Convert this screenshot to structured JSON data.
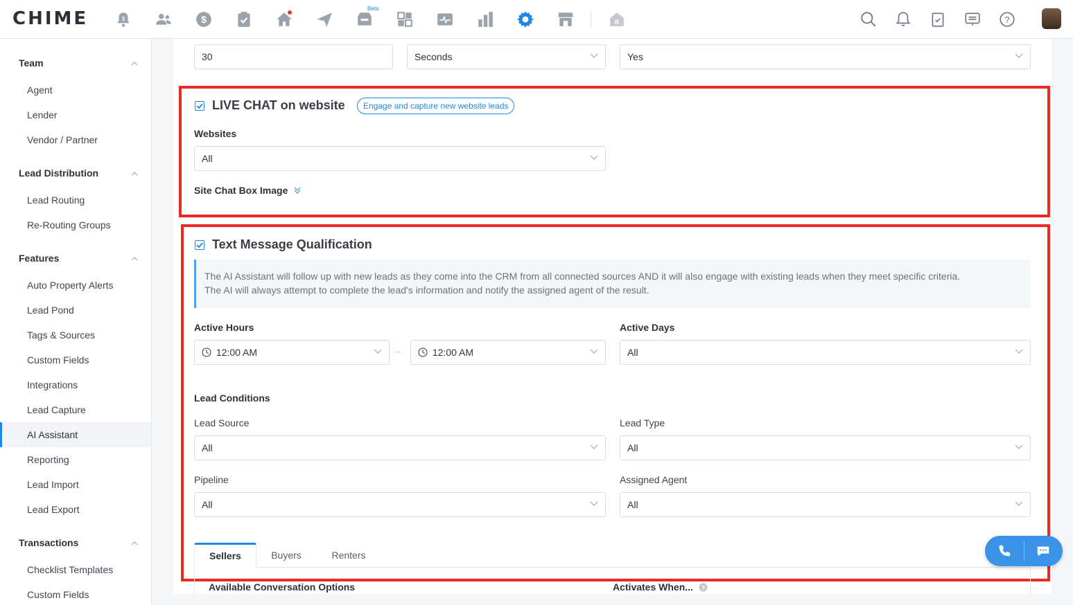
{
  "app": {
    "logo": "CHIME"
  },
  "colors": {
    "accent": "#1e88e5",
    "highlight_box": "#ea2a22",
    "notification_dot": "#e53935"
  },
  "topnav": {
    "icons": [
      "alert-icon",
      "people-icon",
      "dollar-icon",
      "clipboard-icon",
      "home-icon",
      "send-icon",
      "inbox-icon",
      "dashboard-icon",
      "activity-icon",
      "chart-icon",
      "settings-icon",
      "store-icon",
      "building-icon"
    ],
    "beta_label": "Beta",
    "right_icons": [
      "search-icon",
      "bell-icon",
      "task-icon",
      "message-icon",
      "help-icon"
    ]
  },
  "sidebar": {
    "sections": [
      {
        "title": "Team",
        "items": [
          "Agent",
          "Lender",
          "Vendor / Partner"
        ]
      },
      {
        "title": "Lead Distribution",
        "items": [
          "Lead Routing",
          "Re-Routing Groups"
        ]
      },
      {
        "title": "Features",
        "items": [
          "Auto Property Alerts",
          "Lead Pond",
          "Tags & Sources",
          "Custom Fields",
          "Integrations",
          "Lead Capture",
          "AI Assistant",
          "Reporting",
          "Lead Import",
          "Lead Export"
        ]
      },
      {
        "title": "Transactions",
        "items": [
          "Checklist Templates",
          "Custom Fields"
        ]
      }
    ],
    "active_item": "AI Assistant"
  },
  "top_row": {
    "delay_value": "30",
    "unit": "Seconds",
    "enabled": "Yes"
  },
  "live_chat": {
    "checked": true,
    "title": "LIVE CHAT on website",
    "pill": "Engage and capture new website leads",
    "websites_label": "Websites",
    "websites_value": "All",
    "chatbox_label": "Site Chat Box Image"
  },
  "text_qual": {
    "checked": true,
    "title": "Text Message Qualification",
    "info_line1": "The AI Assistant will follow up with new leads as they come into the CRM from all connected sources AND it will also engage with existing leads when they meet specific criteria.",
    "info_line2": "The AI will always attempt to complete the lead's information and notify the assigned agent of the result.",
    "active_hours_label": "Active Hours",
    "start_time": "12:00 AM",
    "dash": "–",
    "end_time": "12:00 AM",
    "active_days_label": "Active Days",
    "active_days_value": "All",
    "lead_conditions_label": "Lead Conditions",
    "lead_source_label": "Lead Source",
    "lead_source_value": "All",
    "lead_type_label": "Lead Type",
    "lead_type_value": "All",
    "pipeline_label": "Pipeline",
    "pipeline_value": "All",
    "assigned_agent_label": "Assigned Agent",
    "assigned_agent_value": "All",
    "tabs": [
      "Sellers",
      "Buyers",
      "Renters"
    ],
    "active_tab": "Sellers",
    "conv_options_label": "Available Conversation Options",
    "activates_when_label": "Activates When..."
  }
}
